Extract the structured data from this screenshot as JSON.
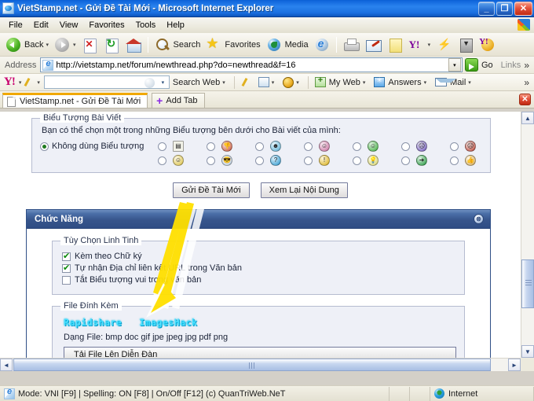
{
  "window": {
    "title": "VietStamp.net - Gửi Đề Tài Mới - Microsoft Internet Explorer",
    "minimize_label": "_",
    "restore_label": "❐",
    "close_label": "✕"
  },
  "menu": {
    "items": [
      "File",
      "Edit",
      "View",
      "Favorites",
      "Tools",
      "Help"
    ]
  },
  "toolbar": {
    "back_label": "Back",
    "search_label": "Search",
    "favorites_label": "Favorites",
    "media_label": "Media",
    "caret": "▾"
  },
  "address": {
    "label": "Address",
    "url": "http://vietstamp.net/forum/newthread.php?do=newthread&f=16",
    "dropdown_caret": "▾",
    "go_label": "Go",
    "links_label": "Links",
    "overflow_caret": "»"
  },
  "yahoo_toolbar": {
    "logo": "Y!",
    "search_value": "",
    "search_placeholder": "",
    "search_web_label": "Search Web",
    "my_web_label": "My Web",
    "answers_label": "Answers",
    "mail_label": "Mail",
    "caret": "▾",
    "overflow_caret": "»"
  },
  "tabs": {
    "active_tab_label": "VietStamp.net - Gửi Đề Tài Mới",
    "add_tab_label": "Add Tab",
    "close_label": "✕"
  },
  "page": {
    "icon_section": {
      "legend": "Biểu Tượng Bài Viết",
      "description": "Bạn có thể chọn một trong những Biểu tượng bên dưới cho Bài viết của mình:",
      "no_icon_label": "Không dùng Biểu tượng",
      "no_icon_selected": true,
      "emoticons": [
        [
          {
            "name": "list-icon",
            "color": "#f2f2e8",
            "glyph": "▤",
            "square": true
          },
          {
            "name": "smile-icon",
            "color": "#f7d94a",
            "glyph": "☺",
            "square": false
          }
        ],
        [
          {
            "name": "thumbs-down-icon",
            "color": "#e05a3a",
            "glyph": "👎",
            "square": false
          },
          {
            "name": "cool-icon",
            "color": "#cfe4f7",
            "glyph": "😎",
            "square": false
          }
        ],
        [
          {
            "name": "wink-icon",
            "color": "#63c6f0",
            "glyph": "☻",
            "square": false
          },
          {
            "name": "question-icon",
            "color": "#2aa8e8",
            "glyph": "?",
            "square": false
          }
        ],
        [
          {
            "name": "blush-icon",
            "color": "#e07ab0",
            "glyph": "☺",
            "square": false
          },
          {
            "name": "exclaim-icon",
            "color": "#f5c518",
            "glyph": "!",
            "square": false
          }
        ],
        [
          {
            "name": "grin-icon",
            "color": "#3fbf3f",
            "glyph": "☺",
            "square": false
          },
          {
            "name": "idea-icon",
            "color": "#f4f07a",
            "glyph": "💡",
            "square": false
          }
        ],
        [
          {
            "name": "angry-icon",
            "color": "#7a5fd0",
            "glyph": "☹",
            "square": false
          },
          {
            "name": "arrow-icon",
            "color": "#1fa83f",
            "glyph": "➜",
            "square": false
          }
        ],
        [
          {
            "name": "red-angry-icon",
            "color": "#d04a3a",
            "glyph": "☹",
            "square": false
          },
          {
            "name": "thumbs-up-icon",
            "color": "#f0c060",
            "glyph": "👍",
            "square": false
          }
        ]
      ],
      "buttons": {
        "submit_label": "Gửi Đề Tài Mới",
        "preview_label": "Xem Lại Nội Dung"
      }
    },
    "functions_panel": {
      "title": "Chức Năng",
      "collapse_icon": "⊗",
      "misc_options": {
        "legend": "Tùy Chọn Linh Tinh",
        "items": [
          {
            "label": "Kèm theo Chữ ký",
            "checked": true
          },
          {
            "label": "Tự nhận Địa chỉ liên kết URL trong Văn bản",
            "checked": true
          },
          {
            "label": "Tắt Biểu tượng vui trong văn bản",
            "checked": false
          }
        ]
      },
      "attachments": {
        "legend": "File Đính Kèm",
        "host_links": [
          "Rapidshare",
          "ImagesHack"
        ],
        "formats_text": "Dạng File: bmp doc gif jpe jpeg jpg pdf png",
        "upload_button_label": "Tải File Lên Diễn Đàn"
      }
    }
  },
  "statusbar": {
    "message": "Mode: VNI [F9] | Spelling: ON [F8] | On/Off [F12] (c) QuanTriWeb.NeT",
    "zone": "Internet"
  },
  "scrollbars": {
    "up_arrow": "▲",
    "down_arrow": "▼",
    "left_arrow": "◄",
    "right_arrow": "►"
  },
  "colors": {
    "titlebar_blue": "#2a83ee",
    "panel_header_blue": "#37558c",
    "host_link_cyan": "#4ae0ff",
    "annotation_yellow": "#ffe000",
    "tab_accent": "#f0a800"
  }
}
